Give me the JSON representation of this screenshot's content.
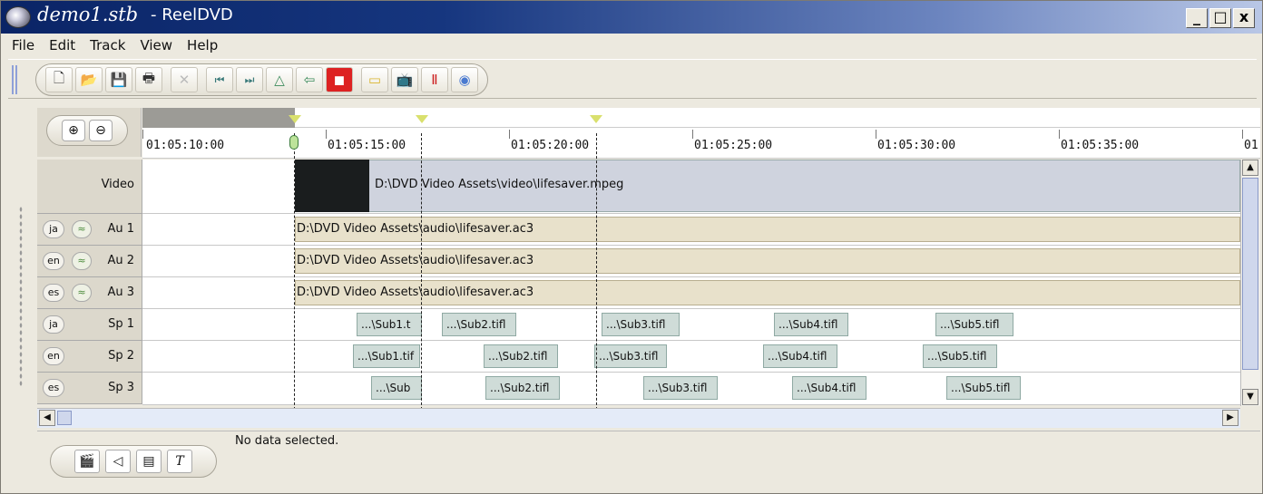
{
  "window": {
    "file_title": "demo1.stb",
    "app_title": "- ReelDVD",
    "minimize": "_",
    "maximize": "□",
    "close": "x"
  },
  "menu": [
    "File",
    "Edit",
    "Track",
    "View",
    "Help"
  ],
  "toolbar_icons": [
    "new-icon",
    "open-icon",
    "save-icon",
    "print-icon",
    "delete-icon",
    "skip-start-icon",
    "skip-end-icon",
    "up-icon",
    "back-icon",
    "snapshot-icon",
    "folder-icon",
    "tv-icon",
    "film-icon",
    "dvd-icon"
  ],
  "timeline": {
    "ticks": [
      "01:05:10:00",
      "01:05:15:00",
      "01:05:20:00",
      "01:05:25:00",
      "01:05:30:00",
      "01:05:35:00",
      "01"
    ]
  },
  "tracks": {
    "video": {
      "label": "Video",
      "clip": "D:\\DVD Video Assets\\video\\lifesaver.mpeg"
    },
    "audio": [
      {
        "lang": "ja",
        "label": "Au 1",
        "clip": "D:\\DVD Video Assets\\audio\\lifesaver.ac3"
      },
      {
        "lang": "en",
        "label": "Au 2",
        "clip": "D:\\DVD Video Assets\\audio\\lifesaver.ac3"
      },
      {
        "lang": "es",
        "label": "Au 3",
        "clip": "D:\\DVD Video Assets\\audio\\lifesaver.ac3"
      }
    ],
    "subpicture": [
      {
        "lang": "ja",
        "label": "Sp 1",
        "clips": [
          "...\\Sub1.t",
          "...\\Sub2.tifl",
          "...\\Sub3.tifl",
          "...\\Sub4.tifl",
          "...\\Sub5.tifl"
        ]
      },
      {
        "lang": "en",
        "label": "Sp 2",
        "clips": [
          "...\\Sub1.tif",
          "...\\Sub2.tifl",
          "...\\Sub3.tifl",
          "...\\Sub4.tifl",
          "...\\Sub5.tifl"
        ]
      },
      {
        "lang": "es",
        "label": "Sp 3",
        "clips": [
          "...\\Sub",
          "...\\Sub2.tifl",
          "...\\Sub3.tifl",
          "...\\Sub4.tifl",
          "...\\Sub5.tifl"
        ]
      }
    ]
  },
  "status": "No data selected.",
  "zoom_buttons": [
    "⊕",
    "⊖"
  ],
  "bottom_buttons": [
    "clapper-icon",
    "speaker-icon",
    "subtitle-icon",
    "text-icon"
  ],
  "colors": {
    "titlebar": "#0a2466",
    "audio_clip": "#e8e1cb",
    "sub_clip": "#cfdcd8",
    "video_clip": "#cfd3de"
  }
}
